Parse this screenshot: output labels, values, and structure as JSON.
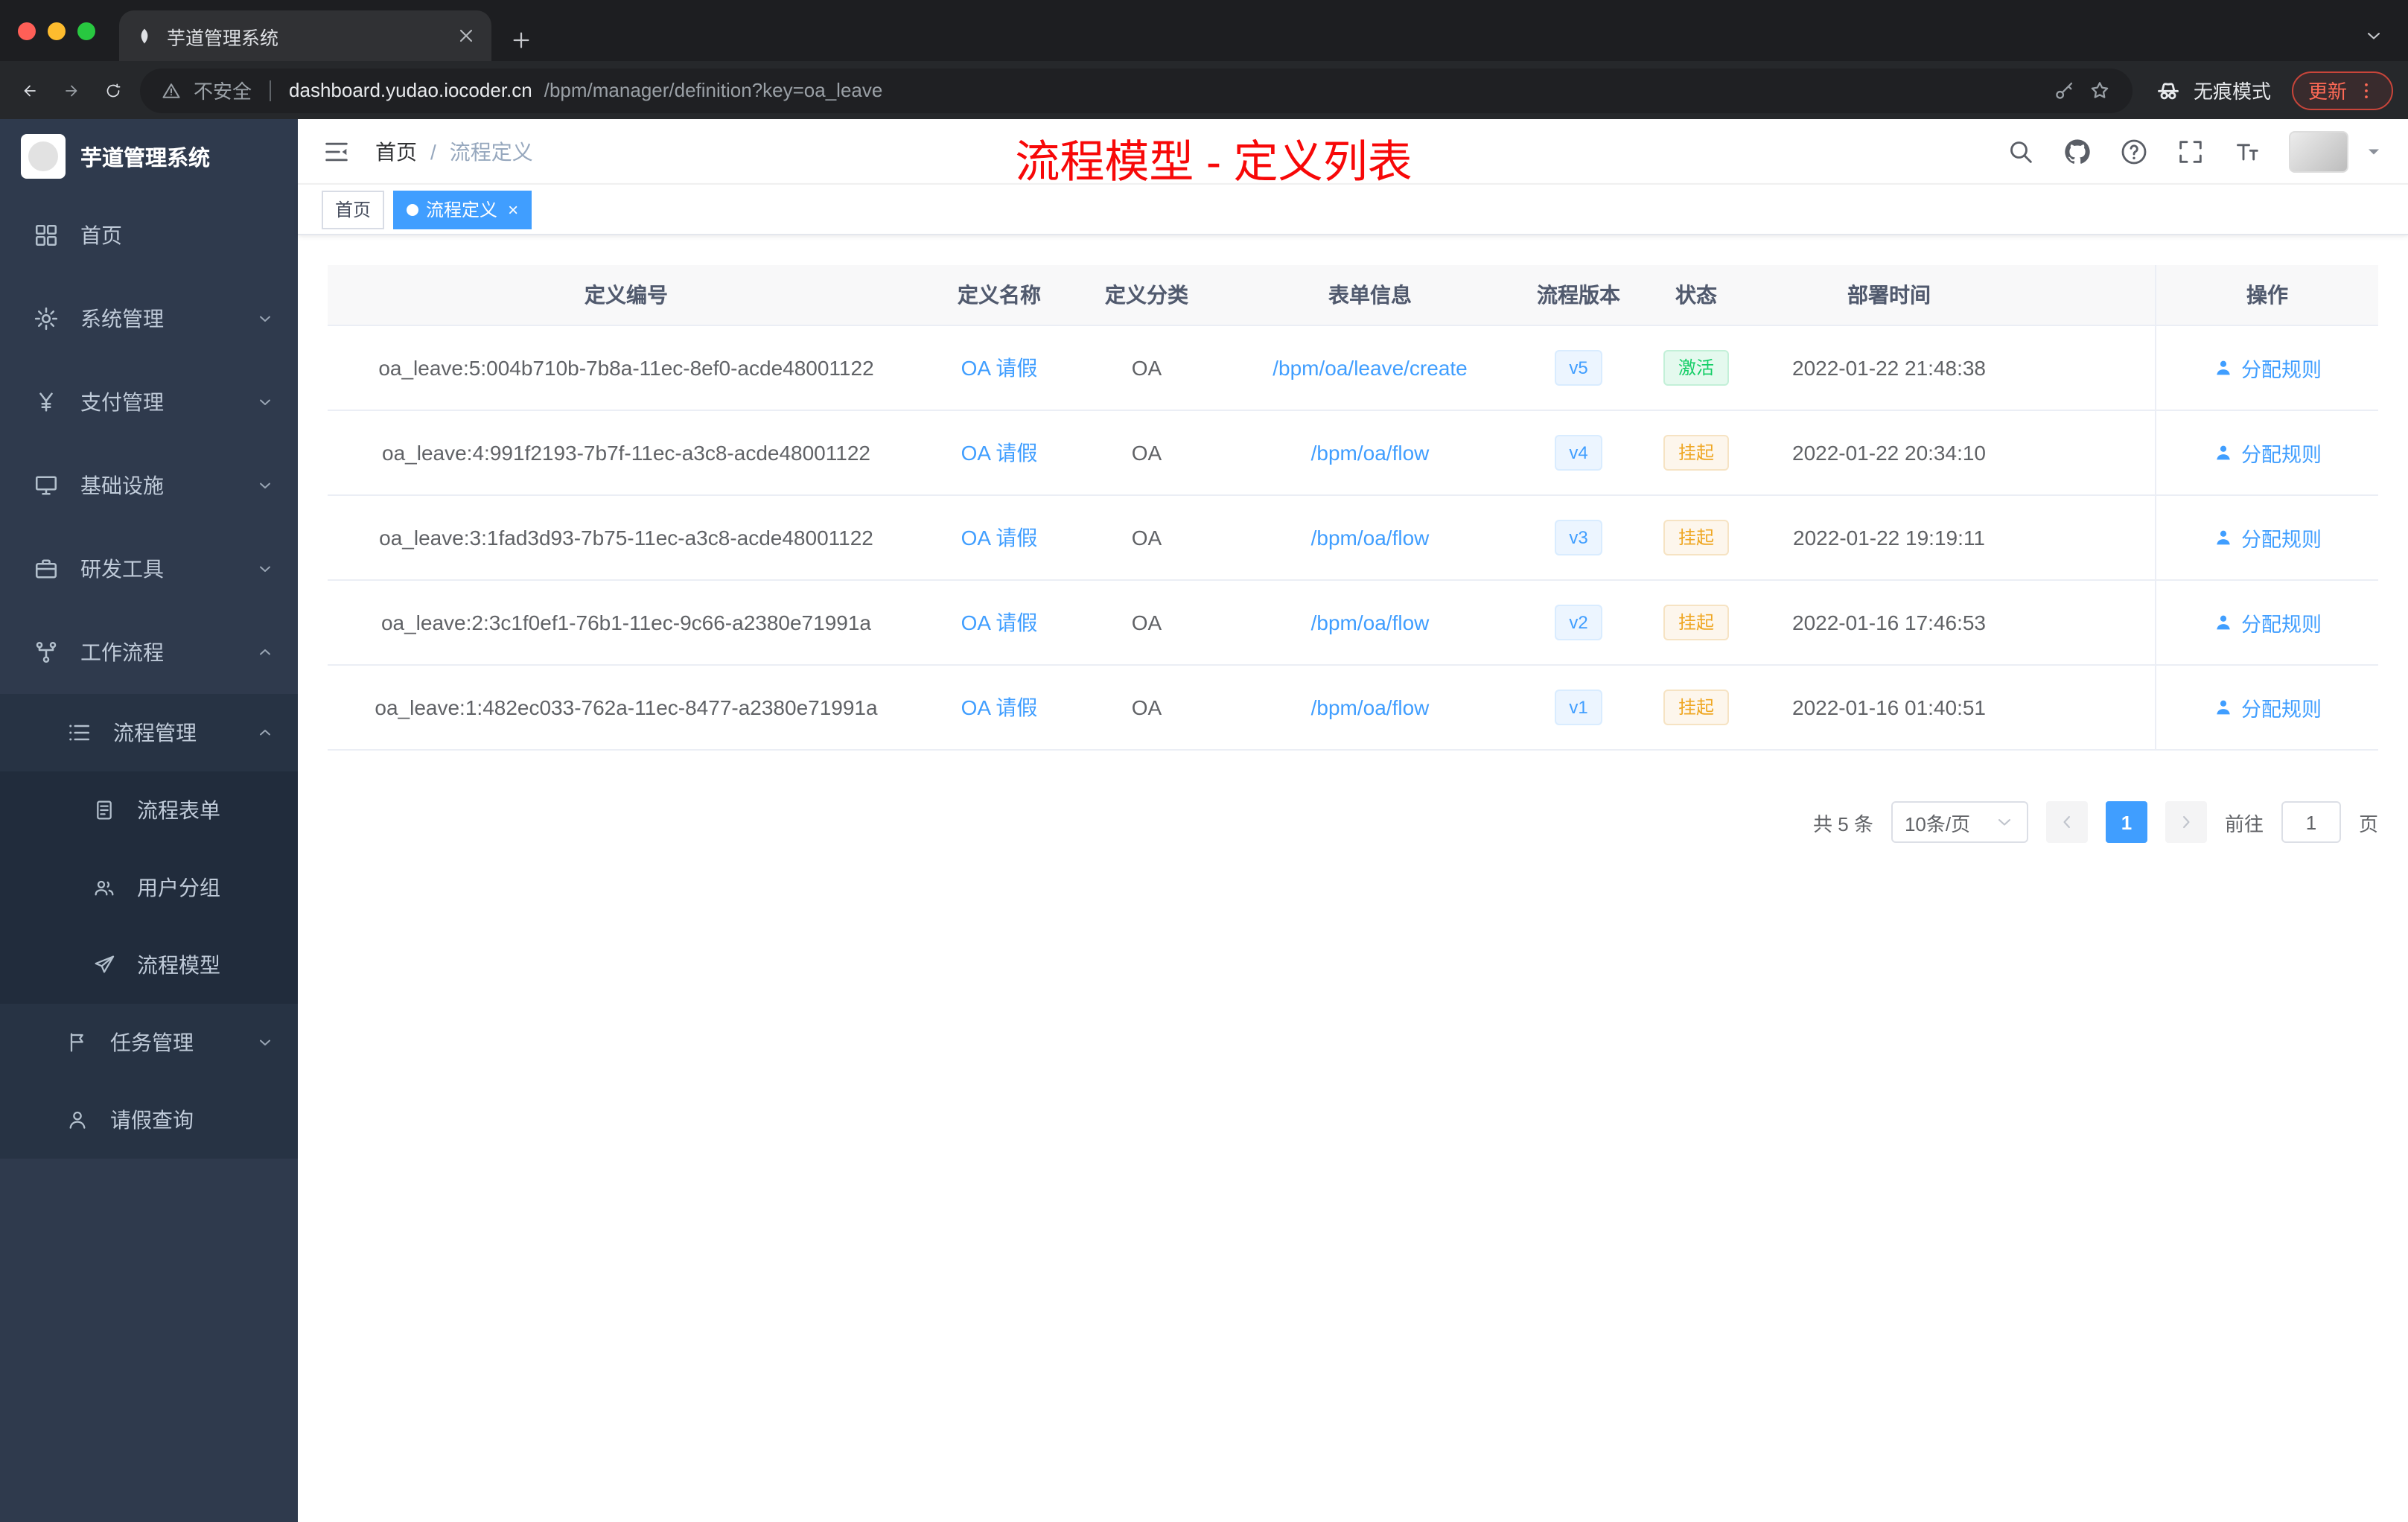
{
  "browser": {
    "tab_title": "芋道管理系统",
    "security_label": "不安全",
    "url_host": "dashboard.yudao.iocoder.cn",
    "url_path": "/bpm/manager/definition?key=oa_leave",
    "incognito_label": "无痕模式",
    "update_label": "更新"
  },
  "sidebar": {
    "app_title": "芋道管理系统",
    "items": [
      {
        "label": "首页"
      },
      {
        "label": "系统管理"
      },
      {
        "label": "支付管理"
      },
      {
        "label": "基础设施"
      },
      {
        "label": "研发工具"
      },
      {
        "label": "工作流程"
      },
      {
        "label": "流程管理"
      },
      {
        "label": "流程表单"
      },
      {
        "label": "用户分组"
      },
      {
        "label": "流程模型"
      },
      {
        "label": "任务管理"
      },
      {
        "label": "请假查询"
      }
    ]
  },
  "navbar": {
    "breadcrumb": [
      "首页",
      "流程定义"
    ],
    "annotation": "流程模型 - 定义列表"
  },
  "tags": [
    {
      "label": "首页"
    },
    {
      "label": "流程定义"
    }
  ],
  "table": {
    "columns": [
      "定义编号",
      "定义名称",
      "定义分类",
      "表单信息",
      "流程版本",
      "状态",
      "部署时间",
      "操作"
    ],
    "action_label": "分配规则",
    "rows": [
      {
        "id": "oa_leave:5:004b710b-7b8a-11ec-8ef0-acde48001122",
        "name": "OA 请假",
        "category": "OA",
        "form": "/bpm/oa/leave/create",
        "version": "v5",
        "status": "激活",
        "status_type": "success",
        "time": "2022-01-22 21:48:38"
      },
      {
        "id": "oa_leave:4:991f2193-7b7f-11ec-a3c8-acde48001122",
        "name": "OA 请假",
        "category": "OA",
        "form": "/bpm/oa/flow",
        "version": "v4",
        "status": "挂起",
        "status_type": "warning",
        "time": "2022-01-22 20:34:10"
      },
      {
        "id": "oa_leave:3:1fad3d93-7b75-11ec-a3c8-acde48001122",
        "name": "OA 请假",
        "category": "OA",
        "form": "/bpm/oa/flow",
        "version": "v3",
        "status": "挂起",
        "status_type": "warning",
        "time": "2022-01-22 19:19:11"
      },
      {
        "id": "oa_leave:2:3c1f0ef1-76b1-11ec-9c66-a2380e71991a",
        "name": "OA 请假",
        "category": "OA",
        "form": "/bpm/oa/flow",
        "version": "v2",
        "status": "挂起",
        "status_type": "warning",
        "time": "2022-01-16 17:46:53"
      },
      {
        "id": "oa_leave:1:482ec033-762a-11ec-8477-a2380e71991a",
        "name": "OA 请假",
        "category": "OA",
        "form": "/bpm/oa/flow",
        "version": "v1",
        "status": "挂起",
        "status_type": "warning",
        "time": "2022-01-16 01:40:51"
      }
    ]
  },
  "pagination": {
    "total": "共 5 条",
    "page_size": "10条/页",
    "current": "1",
    "goto_label": "前往",
    "goto_value": "1",
    "page_label": "页"
  },
  "colors": {
    "accent": "#409eff",
    "success": "#13ce66",
    "warning": "#efa723",
    "annotation": "#f70808",
    "sidebar_bg": "#2f3a4d"
  }
}
